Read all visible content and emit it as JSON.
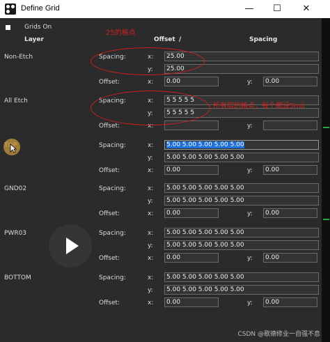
{
  "window": {
    "title": "Define Grid",
    "minimize": "—",
    "maximize": "☐",
    "close": "✕"
  },
  "grids_on": {
    "label": "Grids On",
    "checked": false
  },
  "headers": {
    "layer": "Layer",
    "offset": "Offset",
    "slash": "/",
    "spacing": "Spacing"
  },
  "labels": {
    "spacing": "Spacing:",
    "offset": "Offset:",
    "x": "x:",
    "y": "y:"
  },
  "layers": [
    {
      "name": "Non-Etch",
      "spacing_x": "25.00",
      "spacing_y": "25.00",
      "offset_x": "0.00",
      "offset_y": "0.00"
    },
    {
      "name": "All Etch",
      "spacing_x": "5 5 5 5 5",
      "spacing_y": "5 5 5 5 5",
      "offset_x": "",
      "offset_y": ""
    },
    {
      "name": "TOP",
      "spacing_x": "5.00 5.00 5.00 5.00 5.00",
      "spacing_y": "5.00 5.00 5.00 5.00 5.00",
      "offset_x": "0.00",
      "offset_y": "0.00"
    },
    {
      "name": "GND02",
      "spacing_x": "5.00 5.00 5.00 5.00 5.00",
      "spacing_y": "5.00 5.00 5.00 5.00 5.00",
      "offset_x": "0.00",
      "offset_y": "0.00"
    },
    {
      "name": "PWR03",
      "spacing_x": "5.00 5.00 5.00 5.00 5.00",
      "spacing_y": "5.00 5.00 5.00 5.00 5.00",
      "offset_x": "0.00",
      "offset_y": "0.00"
    },
    {
      "name": "BOTTOM",
      "spacing_x": "5.00 5.00 5.00 5.00 5.00",
      "spacing_y": "5.00 5.00 5.00 5.00 5.00",
      "offset_x": "0.00",
      "offset_y": "0.00"
    }
  ],
  "annotations": {
    "note_1": "25的格点",
    "note_2": "所有层的格点，每个都设5mil"
  },
  "watermark": "CSDN @歌德修业一自强不息",
  "colors": {
    "annotation": "#d11f1f",
    "selection": "#1e6fd9",
    "background": "#2b2b2b"
  },
  "icons": {
    "app": "app-grid-icon",
    "pointer": "mouse-pointer-icon",
    "play": "play-icon"
  }
}
